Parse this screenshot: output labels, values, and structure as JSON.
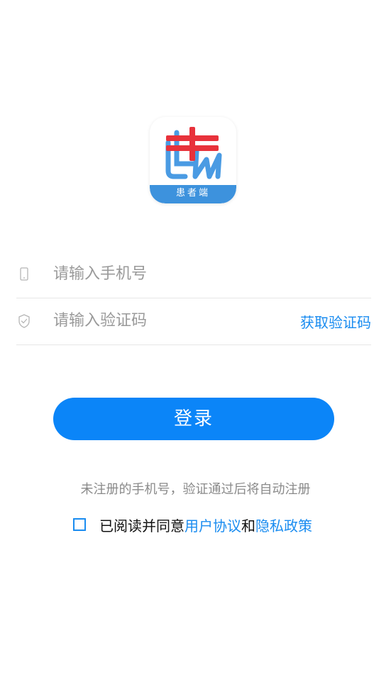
{
  "logo": {
    "caption": "患者端"
  },
  "form": {
    "phone": {
      "placeholder": "请输入手机号",
      "value": ""
    },
    "code": {
      "placeholder": "请输入验证码",
      "value": "",
      "get_code_label": "获取验证码"
    }
  },
  "login": {
    "label": "登录"
  },
  "hint": "未注册的手机号，验证通过后将自动注册",
  "agreement": {
    "prefix": "已阅读并同意",
    "user_agreement": "用户协议",
    "conjunction": "和",
    "privacy_policy": "隐私政策",
    "checked": false
  },
  "colors": {
    "accent": "#0b85f8",
    "link": "#1a8cf0",
    "logo_banner": "#3d92dd",
    "logo_cross": "#e8323b"
  },
  "icons": {
    "phone": "phone-icon",
    "shield": "shield-check-icon",
    "checkbox": "checkbox-icon"
  }
}
